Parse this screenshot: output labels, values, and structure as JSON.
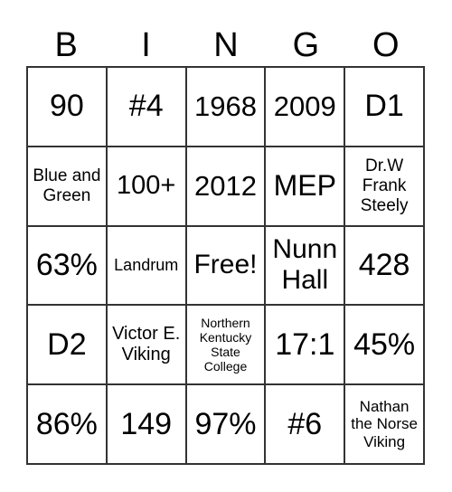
{
  "header": [
    "B",
    "I",
    "N",
    "G",
    "O"
  ],
  "cells": [
    [
      "90",
      "#4",
      "1968",
      "2009",
      "D1"
    ],
    [
      "Blue and Green",
      "100+",
      "2012",
      "MEP",
      "Dr.W Frank Steely"
    ],
    [
      "63%",
      "Landrum",
      "Free!",
      "Nunn Hall",
      "428"
    ],
    [
      "D2",
      "Victor E. Viking",
      "Northern Kentucky State College",
      "17:1",
      "45%"
    ],
    [
      "86%",
      "149",
      "97%",
      "#6",
      "Nathan the Norse Viking"
    ]
  ]
}
